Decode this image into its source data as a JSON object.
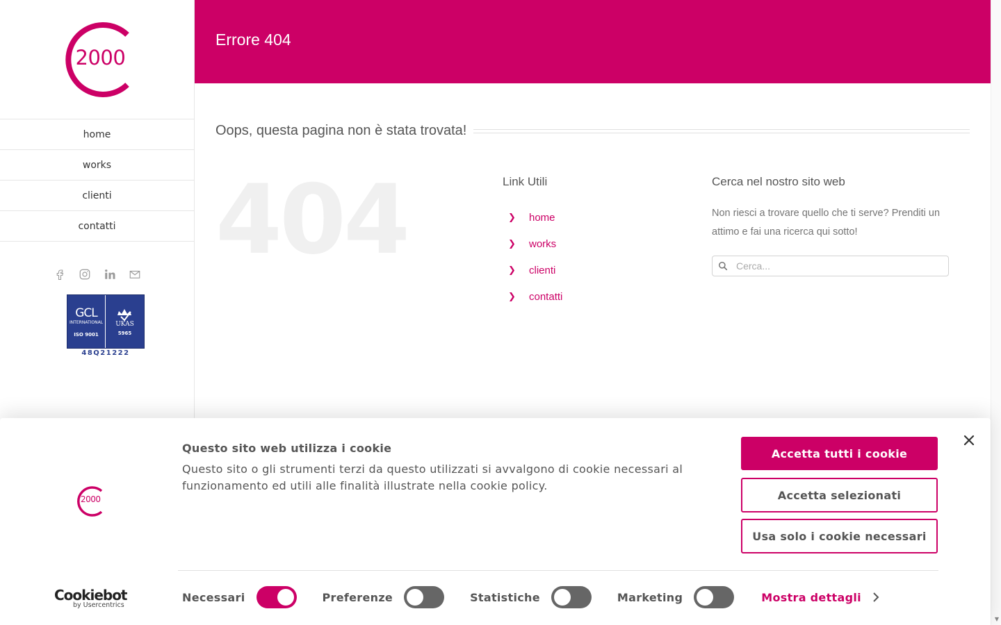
{
  "brand": {
    "accent": "#cc0066",
    "logo_text": "2000"
  },
  "sidebar": {
    "nav": [
      {
        "label": "home"
      },
      {
        "label": "works"
      },
      {
        "label": "clienti"
      },
      {
        "label": "contatti"
      }
    ],
    "socials": [
      "facebook-icon",
      "instagram-icon",
      "linkedin-icon",
      "mail-icon"
    ],
    "cert": {
      "brand": "GCL",
      "sub": "INTERNATIONAL",
      "iso": "ISO 9001",
      "ukas": "UKAS",
      "num": "5965",
      "code": "48Q21222"
    }
  },
  "header": {
    "title": "Errore 404"
  },
  "main": {
    "heading": "Oops, questa pagina non è stata trovata!",
    "big": "404",
    "links": {
      "title": "Link Utili",
      "items": [
        {
          "label": "home"
        },
        {
          "label": "works"
        },
        {
          "label": "clienti"
        },
        {
          "label": "contatti"
        }
      ]
    },
    "search": {
      "title": "Cerca nel nostro sito web",
      "text": "Non riesci a trovare quello che ti serve? Prenditi un attimo e fai una ricerca qui sotto!",
      "placeholder": "Cerca..."
    }
  },
  "cookie": {
    "title": "Questo sito web utilizza i cookie",
    "text": "Questo sito o gli strumenti terzi da questo utilizzati si avvalgono di cookie necessari al funzionamento ed utili alle finalità illustrate nella cookie policy.",
    "accept_all": "Accetta tutti i cookie",
    "accept_selected": "Accetta selezionati",
    "necessary_only": "Usa solo i cookie necessari",
    "toggles": [
      {
        "label": "Necessari",
        "on": true
      },
      {
        "label": "Preferenze",
        "on": false
      },
      {
        "label": "Statistiche",
        "on": false
      },
      {
        "label": "Marketing",
        "on": false
      }
    ],
    "details": "Mostra dettagli",
    "provider": "Cookiebot",
    "provider_by": "by Usercentrics",
    "logo_text": "2000"
  }
}
